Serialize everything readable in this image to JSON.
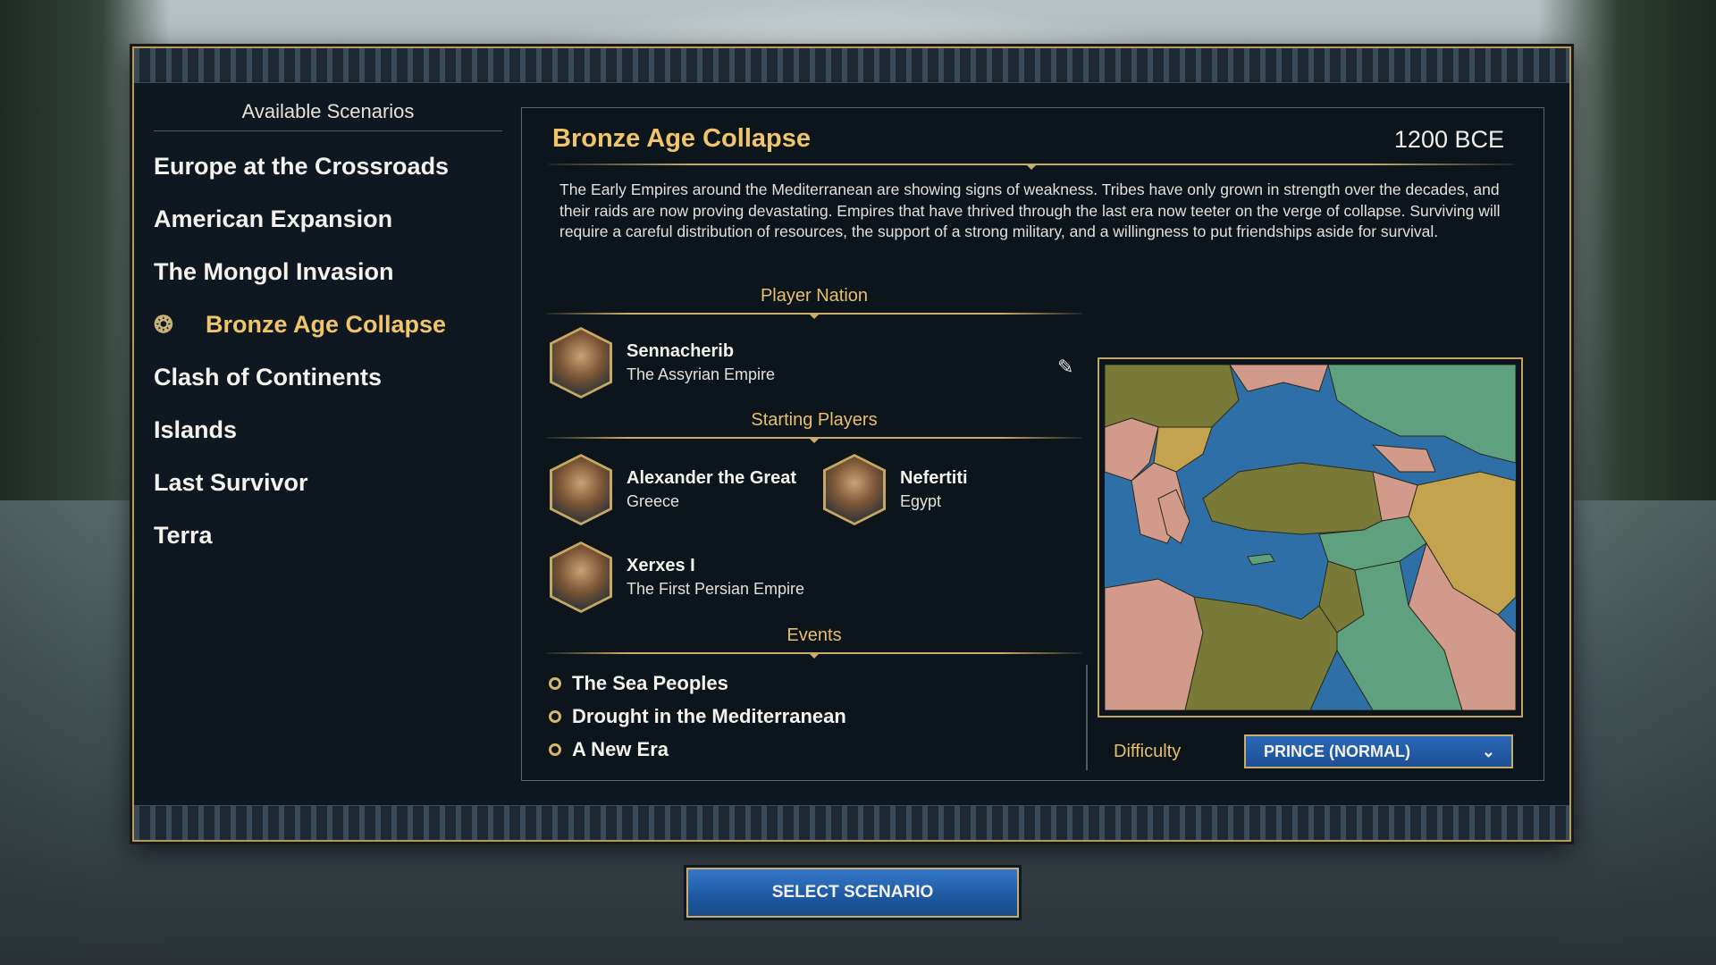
{
  "sidebar": {
    "heading": "Available Scenarios",
    "items": [
      {
        "label": "Europe at the Crossroads",
        "active": false
      },
      {
        "label": "American Expansion",
        "active": false
      },
      {
        "label": "The Mongol Invasion",
        "active": false
      },
      {
        "label": "Bronze Age Collapse",
        "active": true
      },
      {
        "label": "Clash of Continents",
        "active": false
      },
      {
        "label": "Islands",
        "active": false
      },
      {
        "label": "Last Survivor",
        "active": false
      },
      {
        "label": "Terra",
        "active": false
      }
    ]
  },
  "scenario": {
    "title": "Bronze Age Collapse",
    "date": "1200 BCE",
    "description": "The Early Empires around the Mediterranean are showing signs of weakness. Tribes have only grown in strength over the decades, and their raids are now proving devastating. Empires that have thrived through the last era now teeter on the verge of collapse. Surviving will require a careful distribution of resources, the support of a strong military, and a willingness to put friendships aside for survival."
  },
  "player_nation": {
    "heading": "Player Nation",
    "leader": "Sennacherib",
    "civ": "The Assyrian Empire"
  },
  "starting_players": {
    "heading": "Starting Players",
    "players": [
      {
        "leader": "Alexander the Great",
        "civ": "Greece"
      },
      {
        "leader": "Nefertiti",
        "civ": "Egypt"
      },
      {
        "leader": "Xerxes I",
        "civ": "The First Persian Empire"
      }
    ]
  },
  "events": {
    "heading": "Events",
    "items": [
      "The Sea Peoples",
      "Drought in the Mediterranean",
      "A New Era"
    ]
  },
  "difficulty": {
    "label": "Difficulty",
    "value": "PRINCE (NORMAL)"
  },
  "select_button": "SELECT SCENARIO",
  "colors": {
    "gold": "#f0c56a",
    "panel": "#0d151c",
    "button_blue": "#1f5aa3",
    "map_sea": "#2e6fa8",
    "map_olive": "#7a7a38",
    "map_pink": "#d29a8a",
    "map_green": "#5fa17f",
    "map_yellow": "#c4a34e"
  },
  "icons": [
    "scenario-marker-icon",
    "edit-pencil-icon",
    "chevron-down-icon",
    "bullet-icon"
  ]
}
